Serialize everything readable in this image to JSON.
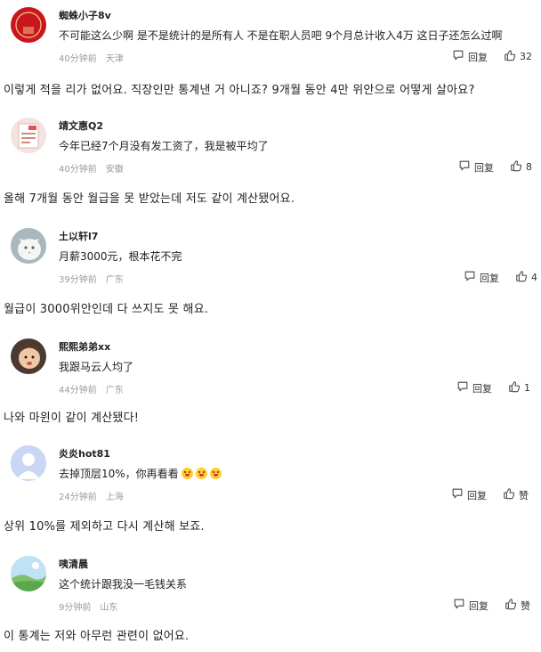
{
  "comments": [
    {
      "username": "蜘蛛小子8v",
      "text": "不可能这么少啊 是不是统计的是所有人 不是在职人员吧 9个月总计收入4万 这日子还怎么过啊",
      "time": "40分钟前",
      "location": "天津",
      "reply_label": "回复",
      "likes": "32",
      "translation": "이렇게 적을 리가 없어요. 직장인만 통계낸 거 아니죠? 9개월 동안 4만 위안으로 어떻게 살아요?",
      "avatar_icon": "red-seal-avatar",
      "avatar_text": "福"
    },
    {
      "username": "靖文惠Q2",
      "text": "今年已经7个月没有发工资了，我是被平均了",
      "time": "40分钟前",
      "location": "安徽",
      "reply_label": "回复",
      "likes": "8",
      "translation": "올해 7개월 동안 월급을 못 받았는데 저도 같이 계산됐어요.",
      "avatar_icon": "card-avatar"
    },
    {
      "username": "土以轩l7",
      "text": "月薪3000元，根本花不完",
      "time": "39分钟前",
      "location": "广东",
      "reply_label": "回复",
      "likes": "4",
      "translation": "월급이 3000위안인데 다 쓰지도 못 해요.",
      "avatar_icon": "white-cat-avatar"
    },
    {
      "username": "熙熙弟弟xx",
      "text": "我跟马云人均了",
      "time": "44分钟前",
      "location": "广东",
      "reply_label": "回复",
      "likes": "1",
      "translation": "나와 마윈이 같이 계산됐다!",
      "avatar_icon": "child-photo-avatar"
    },
    {
      "username": "炎炎hot81",
      "text": "去掉顶层10%，你再看看",
      "time": "24分钟前",
      "location": "上海",
      "reply_label": "回复",
      "likes": "赞",
      "translation": "상위 10%를 제외하고 다시 계산해 보죠.",
      "avatar_icon": "default-user-avatar",
      "emoji_count": 3
    },
    {
      "username": "咦清晨",
      "text": "这个统计跟我没一毛钱关系",
      "time": "9分钟前",
      "location": "山东",
      "reply_label": "回复",
      "likes": "赞",
      "translation": "이 통계는 저와 아무런 관련이 없어요.",
      "avatar_icon": "landscape-avatar"
    }
  ],
  "icons": {
    "reply": "comment-bubble-icon",
    "like": "thumbs-up-icon"
  },
  "colors": {
    "meta": "#9a9a9a",
    "text": "#222222"
  }
}
